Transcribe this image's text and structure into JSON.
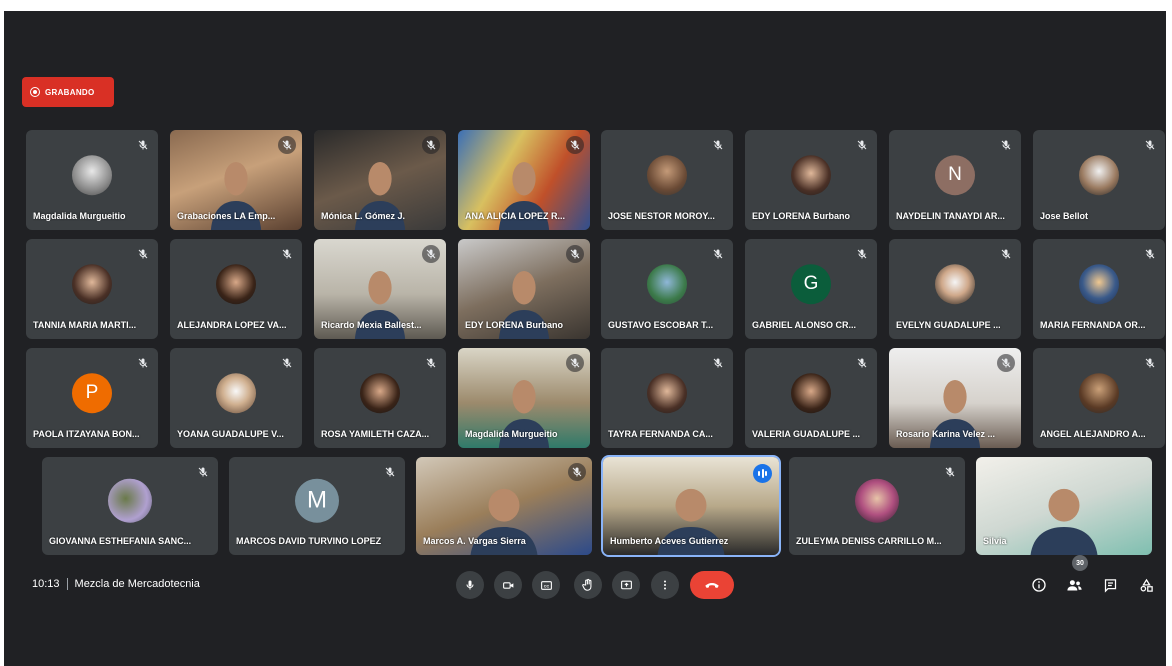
{
  "recording": {
    "label": "GRABANDO",
    "color": "#d93025"
  },
  "meeting": {
    "time": "10:13",
    "title": "Mezcla de Mercadotecnia",
    "participant_count": "30"
  },
  "rows": [
    [
      {
        "name": "Magdalida Murgueitio",
        "type": "avatar",
        "img": "dog",
        "muted": true
      },
      {
        "name": "Grabaciones LA Emp...",
        "type": "video",
        "scene": "warm",
        "muted": true
      },
      {
        "name": "Mónica L. Gómez J.",
        "type": "video",
        "scene": "room",
        "muted": true
      },
      {
        "name": "ANA ALICIA LOPEZ R...",
        "type": "video",
        "scene": "flags",
        "muted": true
      },
      {
        "name": "JOSE NESTOR MOROY...",
        "type": "avatar",
        "img": "man",
        "muted": true
      },
      {
        "name": "EDY LORENA Burbano",
        "type": "avatar",
        "img": "woman",
        "muted": true
      },
      {
        "name": "NAYDELIN TANAYDI AR...",
        "type": "letter",
        "letter": "N",
        "color": "#8d6e63",
        "muted": true
      },
      {
        "name": "Jose Bellot",
        "type": "avatar",
        "img": "man2",
        "muted": true
      }
    ],
    [
      {
        "name": "TANNIA MARIA MARTI...",
        "type": "avatar",
        "img": "woman",
        "muted": true
      },
      {
        "name": "ALEJANDRA LOPEZ VA...",
        "type": "avatar",
        "img": "woman2",
        "muted": true
      },
      {
        "name": "Ricardo Mexia Ballest...",
        "type": "video",
        "scene": "office",
        "muted": true
      },
      {
        "name": "EDY LORENA Burbano",
        "type": "video",
        "scene": "desk",
        "muted": true
      },
      {
        "name": "GUSTAVO ESCOBAR T...",
        "type": "avatar",
        "img": "nature",
        "muted": true
      },
      {
        "name": "GABRIEL ALONSO CR...",
        "type": "letter",
        "letter": "G",
        "color": "#0b5d3b",
        "muted": true
      },
      {
        "name": "EVELYN GUADALUPE ...",
        "type": "avatar",
        "img": "woman3",
        "muted": true
      },
      {
        "name": "MARIA FERNANDA OR...",
        "type": "avatar",
        "img": "sky",
        "muted": true
      }
    ],
    [
      {
        "name": "PAOLA ITZAYANA BON...",
        "type": "letter",
        "letter": "P",
        "color": "#ef6c00",
        "muted": true
      },
      {
        "name": "YOANA GUADALUPE V...",
        "type": "avatar",
        "img": "woman4",
        "muted": true
      },
      {
        "name": "ROSA YAMILETH CAZA...",
        "type": "avatar",
        "img": "woman2",
        "muted": true
      },
      {
        "name": "Magdalida Murgueitio",
        "type": "video",
        "scene": "green",
        "muted": true
      },
      {
        "name": "TAYRA FERNANDA CA...",
        "type": "avatar",
        "img": "woman",
        "muted": true
      },
      {
        "name": "VALERIA GUADALUPE ...",
        "type": "avatar",
        "img": "woman2",
        "muted": true
      },
      {
        "name": "Rosario Karina Velez ...",
        "type": "video",
        "scene": "white",
        "muted": true
      },
      {
        "name": "ANGEL ALEJANDRO A...",
        "type": "avatar",
        "img": "man3",
        "muted": true
      }
    ],
    [
      {
        "name": "GIOVANNA ESTHEFANIA SANC...",
        "type": "avatar",
        "img": "outdoor",
        "muted": true
      },
      {
        "name": "MARCOS DAVID TURVINO LOPEZ",
        "type": "letter",
        "letter": "M",
        "color": "#78909c",
        "muted": true
      },
      {
        "name": "Marcos A. Vargas Sierra",
        "type": "video",
        "scene": "home",
        "muted": true
      },
      {
        "name": "Humberto Aceves Gutierrez",
        "type": "video",
        "scene": "suit",
        "muted": false,
        "speaking": true
      },
      {
        "name": "ZULEYMA DENISS CARRILLO M...",
        "type": "avatar",
        "img": "woman5",
        "muted": true
      },
      {
        "name": "Silvia",
        "type": "video",
        "scene": "bright",
        "muted": false
      }
    ]
  ],
  "controls": [
    {
      "name": "microphone",
      "icon": "mic-icon"
    },
    {
      "name": "camera",
      "icon": "camera-icon"
    },
    {
      "name": "captions",
      "icon": "captions-icon"
    },
    {
      "name": "raise-hand",
      "icon": "hand-icon"
    },
    {
      "name": "present",
      "icon": "present-icon"
    },
    {
      "name": "more-options",
      "icon": "more-icon"
    }
  ],
  "end_call": {
    "icon": "phone-hangup-icon",
    "color": "#ea4335"
  },
  "right_tools": [
    {
      "name": "meeting-details",
      "icon": "info-icon"
    },
    {
      "name": "people",
      "icon": "people-icon"
    },
    {
      "name": "chat",
      "icon": "chat-icon"
    },
    {
      "name": "activities",
      "icon": "activities-icon"
    }
  ]
}
